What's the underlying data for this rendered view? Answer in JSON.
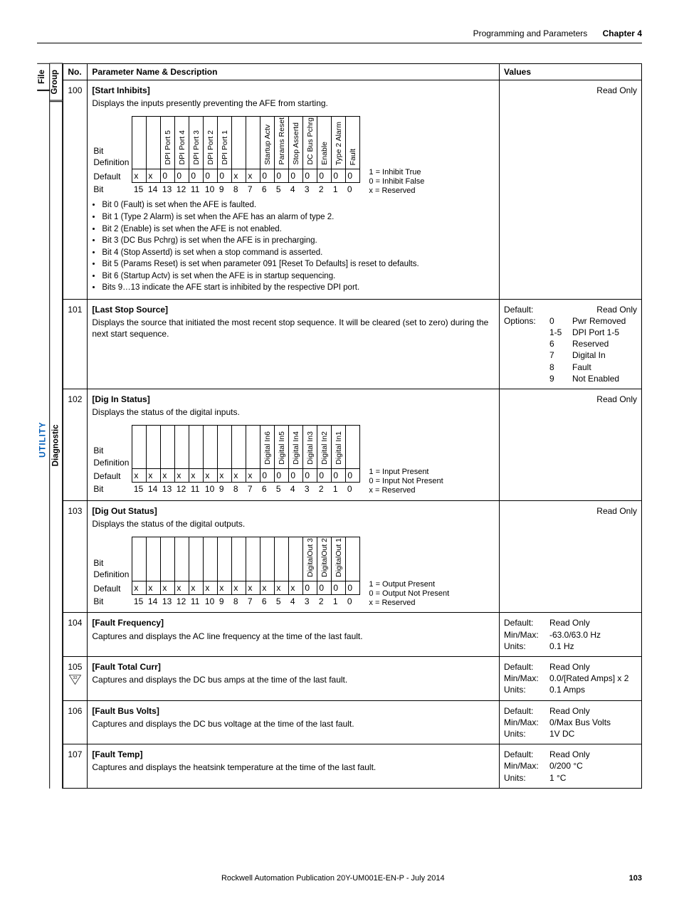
{
  "header": {
    "section": "Programming and Parameters",
    "chapter": "Chapter 4"
  },
  "columns": {
    "file": "File",
    "group": "Group",
    "no": "No.",
    "name": "Parameter Name & Description",
    "values": "Values"
  },
  "sidebar": {
    "file_label": "UTILITY",
    "group_label": "Diagnostic"
  },
  "legends": {
    "inhibit": {
      "one": "1 = Inhibit True",
      "zero": "0 = Inhibit False",
      "x": "x = Reserved"
    },
    "input": {
      "one": "1 = Input Present",
      "zero": "0 = Input Not Present",
      "x": "x = Reserved"
    },
    "output": {
      "one": "1 = Output Present",
      "zero": "0 = Output Not Present",
      "x": "x = Reserved"
    }
  },
  "bit_label": "Bit Definition",
  "default_label": "Default",
  "bitrow_label": "Bit",
  "rows": [
    {
      "no": "100",
      "name": "[Start Inhibits]",
      "desc": "Displays the inputs presently preventing the AFE from starting.",
      "readonly": "Read Only",
      "bits_headers": [
        "",
        "",
        "DPI Port 5",
        "DPI Port 4",
        "DPI Port 3",
        "DPI Port 2",
        "DPI Port 1",
        "",
        "",
        "Startup Actv",
        "Params Reset",
        "Stop Assertd",
        "DC Bus Pchrg",
        "Enable",
        "Type 2 Alarm",
        "Fault"
      ],
      "defaults": [
        "x",
        "x",
        "0",
        "0",
        "0",
        "0",
        "0",
        "x",
        "x",
        "0",
        "0",
        "0",
        "0",
        "0",
        "0",
        "0"
      ],
      "bitnums": [
        "15",
        "14",
        "13",
        "12",
        "11",
        "10",
        "9",
        "8",
        "7",
        "6",
        "5",
        "4",
        "3",
        "2",
        "1",
        "0"
      ],
      "bullets": [
        "Bit 0 (Fault) is set when the AFE is faulted.",
        "Bit 1 (Type 2 Alarm) is set when the AFE has an alarm of type 2.",
        "Bit 2 (Enable) is set when the AFE is not enabled.",
        "Bit 3 (DC Bus Pchrg) is set when the AFE is in precharging.",
        "Bit 4 (Stop Assertd) is set when a stop command is asserted.",
        "Bit 5 (Params Reset) is set when parameter 091 [Reset To Defaults] is reset to defaults.",
        "Bit 6 (Startup Actv) is set when the AFE is in startup sequencing.",
        "Bits 9…13 indicate the AFE start is inhibited by the respective DPI port."
      ]
    },
    {
      "no": "101",
      "name": "[Last Stop Source]",
      "desc": "Displays the source that initiated the most recent stop sequence. It will be cleared (set to zero) during the next start sequence.",
      "values": {
        "default": "Default:",
        "options_label": "Options:",
        "readonly": "Read Only",
        "options": [
          {
            "c": "0",
            "t": "Pwr Removed"
          },
          {
            "c": "1-5",
            "t": "DPI Port 1-5"
          },
          {
            "c": "6",
            "t": "Reserved"
          },
          {
            "c": "7",
            "t": "Digital In"
          },
          {
            "c": "8",
            "t": "Fault"
          },
          {
            "c": "9",
            "t": "Not Enabled"
          }
        ]
      }
    },
    {
      "no": "102",
      "name": "[Dig In Status]",
      "desc": "Displays the status of the digital inputs.",
      "readonly": "Read Only",
      "bits_headers": [
        "",
        "",
        "",
        "",
        "",
        "",
        "",
        "",
        "",
        "Digital In6",
        "Digital In5",
        "Digital In4",
        "Digital In3",
        "Digital In2",
        "Digital In1",
        ""
      ],
      "defaults": [
        "x",
        "x",
        "x",
        "x",
        "x",
        "x",
        "x",
        "x",
        "x",
        "0",
        "0",
        "0",
        "0",
        "0",
        "0",
        "0"
      ],
      "bitnums": [
        "15",
        "14",
        "13",
        "12",
        "11",
        "10",
        "9",
        "8",
        "7",
        "6",
        "5",
        "4",
        "3",
        "2",
        "1",
        "0"
      ]
    },
    {
      "no": "103",
      "name": "[Dig Out Status]",
      "desc": "Displays the status of the digital outputs.",
      "readonly": "Read Only",
      "bits_headers": [
        "",
        "",
        "",
        "",
        "",
        "",
        "",
        "",
        "",
        "",
        "",
        "",
        "DigitalOut 3",
        "DigitalOut 2",
        "DigitalOut 1",
        ""
      ],
      "defaults": [
        "x",
        "x",
        "x",
        "x",
        "x",
        "x",
        "x",
        "x",
        "x",
        "x",
        "x",
        "x",
        "0",
        "0",
        "0",
        "0"
      ],
      "bitnums": [
        "15",
        "14",
        "13",
        "12",
        "11",
        "10",
        "9",
        "8",
        "7",
        "6",
        "5",
        "4",
        "3",
        "2",
        "1",
        "0"
      ]
    },
    {
      "no": "104",
      "name": "[Fault Frequency]",
      "desc": "Captures and displays the AC line frequency at the time of the last fault.",
      "vals": {
        "Default:": "Read Only",
        "Min/Max:": "-63.0/63.0 Hz",
        "Units:": "0.1 Hz"
      }
    },
    {
      "no": "105",
      "name": "[Fault Total Curr]",
      "desc": "Captures and displays the DC bus amps at the time of the last fault.",
      "icon32": true,
      "vals": {
        "Default:": "Read Only",
        "Min/Max:": "0.0/[Rated Amps] x 2",
        "Units:": "0.1 Amps"
      }
    },
    {
      "no": "106",
      "name": "[Fault Bus Volts]",
      "desc": "Captures and displays the DC bus voltage at the time of the last fault.",
      "vals": {
        "Default:": "Read Only",
        "Min/Max:": "0/Max Bus Volts",
        "Units:": "1V DC"
      }
    },
    {
      "no": "107",
      "name": "[Fault Temp]",
      "desc": "Captures and displays the heatsink temperature at the time of the last fault.",
      "vals": {
        "Default:": "Read Only",
        "Min/Max:": "0/200 °C",
        "Units:": "1 °C"
      }
    }
  ],
  "footer": {
    "text": "Rockwell Automation Publication 20Y-UM001E-EN-P - July 2014",
    "page": "103"
  }
}
